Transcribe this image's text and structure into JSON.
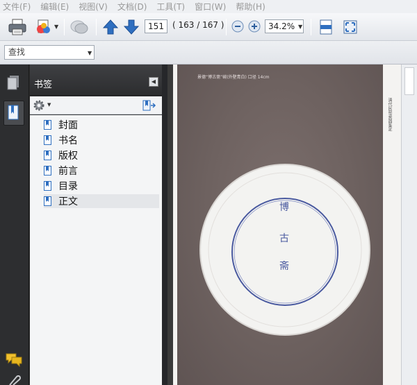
{
  "menu": [
    "文件(F)",
    "编辑(E)",
    "视图(V)",
    "文档(D)",
    "工具(T)",
    "窗口(W)",
    "帮助(H)"
  ],
  "toolbar": {
    "page_number": "151",
    "page_count": "( 163 / 167 )",
    "zoom": "34.2%"
  },
  "find": {
    "placeholder": "查找"
  },
  "bookmarks": {
    "title": "书签",
    "items": [
      {
        "label": "封面"
      },
      {
        "label": "书名"
      },
      {
        "label": "版权"
      },
      {
        "label": "前言"
      },
      {
        "label": "目录"
      },
      {
        "label": "正文"
      }
    ],
    "selected": "正文"
  },
  "document": {
    "caption": "景德“博古斋”碗(外壁青白)  口径 14cm",
    "side_caption": "清代民窑瓷器鉴定",
    "plate_marks": [
      "博",
      "古",
      "斋"
    ]
  },
  "colors": {
    "accent_blue": "#2f6fc0",
    "plate_blue": "#4a5aa0"
  }
}
